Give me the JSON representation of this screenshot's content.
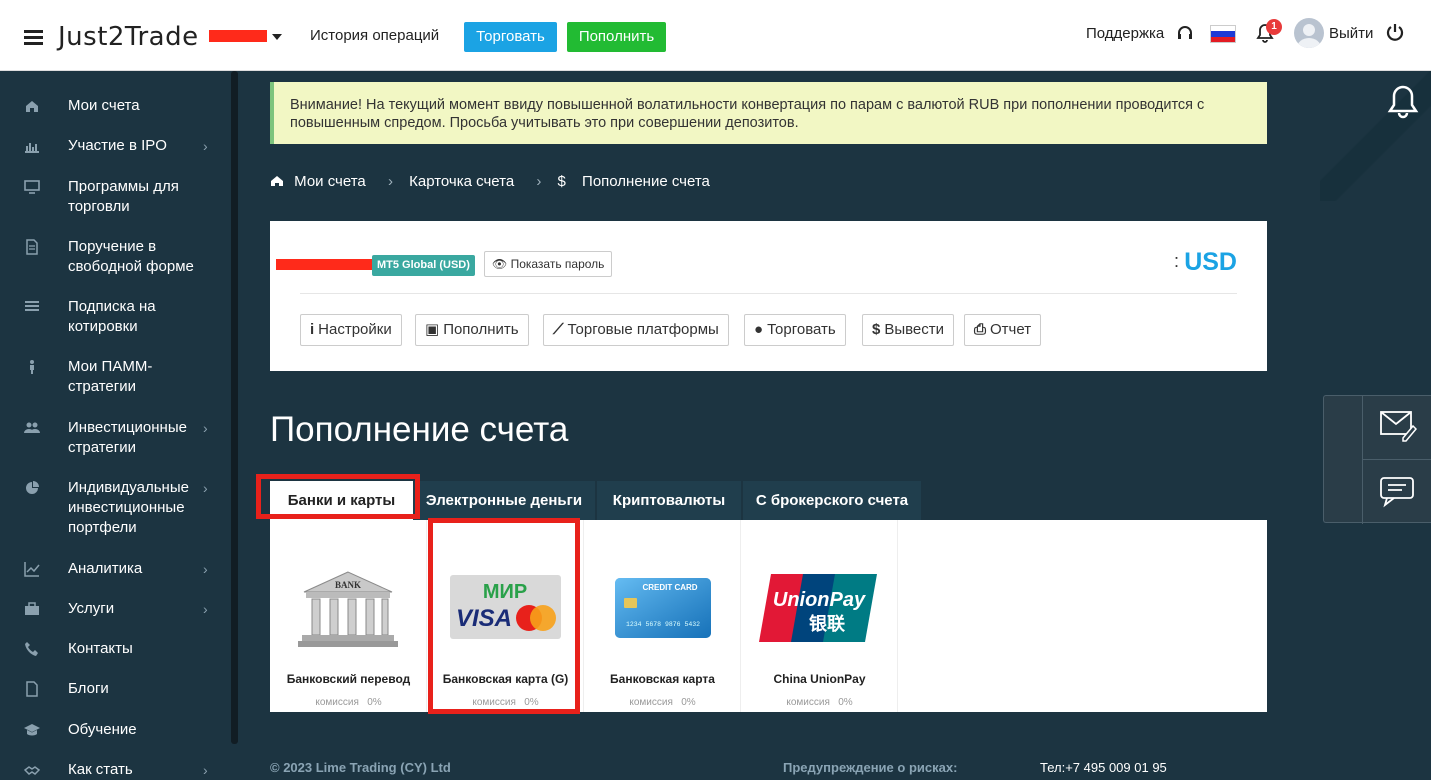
{
  "header": {
    "logo": "Just2Trade",
    "history": "История операций",
    "trade_btn": "Торговать",
    "deposit_btn": "Пополнить",
    "support": "Поддержка",
    "notifications_count": "1",
    "logout": "Выйти"
  },
  "sidebar": {
    "items": [
      {
        "label": "Мои счета",
        "icon": "home-icon",
        "has_submenu": false
      },
      {
        "label": "Участие в IPO",
        "icon": "bar-chart-icon",
        "has_submenu": true
      },
      {
        "label": "Программы для торговли",
        "icon": "monitor-icon",
        "has_submenu": false
      },
      {
        "label": "Поручение в свободной форме",
        "icon": "document-icon",
        "has_submenu": false
      },
      {
        "label": "Подписка на котировки",
        "icon": "list-icon",
        "has_submenu": false
      },
      {
        "label": "Мои ПАММ-стратегии",
        "icon": "person-icon",
        "has_submenu": false
      },
      {
        "label": "Инвестиционные стратегии",
        "icon": "users-icon",
        "has_submenu": true
      },
      {
        "label": "Индивидуальные инвестиционные портфели",
        "icon": "pie-chart-icon",
        "has_submenu": true
      },
      {
        "label": "Аналитика",
        "icon": "line-chart-icon",
        "has_submenu": true
      },
      {
        "label": "Услуги",
        "icon": "briefcase-icon",
        "has_submenu": true
      },
      {
        "label": "Контакты",
        "icon": "phone-icon",
        "has_submenu": false
      },
      {
        "label": "Блоги",
        "icon": "file-icon",
        "has_submenu": false
      },
      {
        "label": "Обучение",
        "icon": "graduation-cap-icon",
        "has_submenu": false
      },
      {
        "label": "Как стать",
        "icon": "handshake-icon",
        "has_submenu": true
      }
    ]
  },
  "alert": {
    "text": "Внимание! На текущий момент ввиду повышенной волатильности конвертация по парам с валютой RUB при пополнении проводится с повышенным спредом. Просьба учитывать это при совершении депозитов."
  },
  "breadcrumb": {
    "items": [
      "Мои счета",
      "Карточка счета",
      "Пополнение счета"
    ]
  },
  "account": {
    "type_badge": "MT5 Global (USD)",
    "show_password": "Показать пароль",
    "currency": "USD",
    "actions": [
      "Настройки",
      "Пополнить",
      "Торговые платформы",
      "Торговать",
      "Вывести",
      "Отчет"
    ]
  },
  "page_title": "Пополнение счета",
  "tabs": [
    "Банки и карты",
    "Электронные деньги",
    "Криптовалюты",
    "С брокерского счета"
  ],
  "methods": [
    {
      "name": "Банковский перевод",
      "commission_label": "комиссия",
      "commission": "0%",
      "icon": "bank-building-icon"
    },
    {
      "name": "Банковская карта (G)",
      "commission_label": "комиссия",
      "commission": "0%",
      "icon": "mir-visa-mastercard-icon"
    },
    {
      "name": "Банковская карта",
      "commission_label": "комиссия",
      "commission": "0%",
      "icon": "credit-card-icon"
    },
    {
      "name": "China UnionPay",
      "commission_label": "комиссия",
      "commission": "0%",
      "icon": "unionpay-icon"
    }
  ],
  "logos": {
    "bank_text": "BANK",
    "mir": "МИР",
    "visa": "VISA",
    "credit_card": "CREDIT CARD",
    "card_number": "1234 5678 9876 5432",
    "unionpay": "UnionPay",
    "unionpay_cn": "银联"
  },
  "footer": {
    "copyright": "© 2023 Lime Trading (CY) Ltd",
    "risk": "Предупреждение о рисках:",
    "phone": "Тел:+7 495 009 01 95"
  },
  "colors": {
    "background": "#1c3441",
    "accent_blue": "#1ba3e4",
    "accent_green": "#22bb33",
    "highlight_red": "#e8211b"
  }
}
